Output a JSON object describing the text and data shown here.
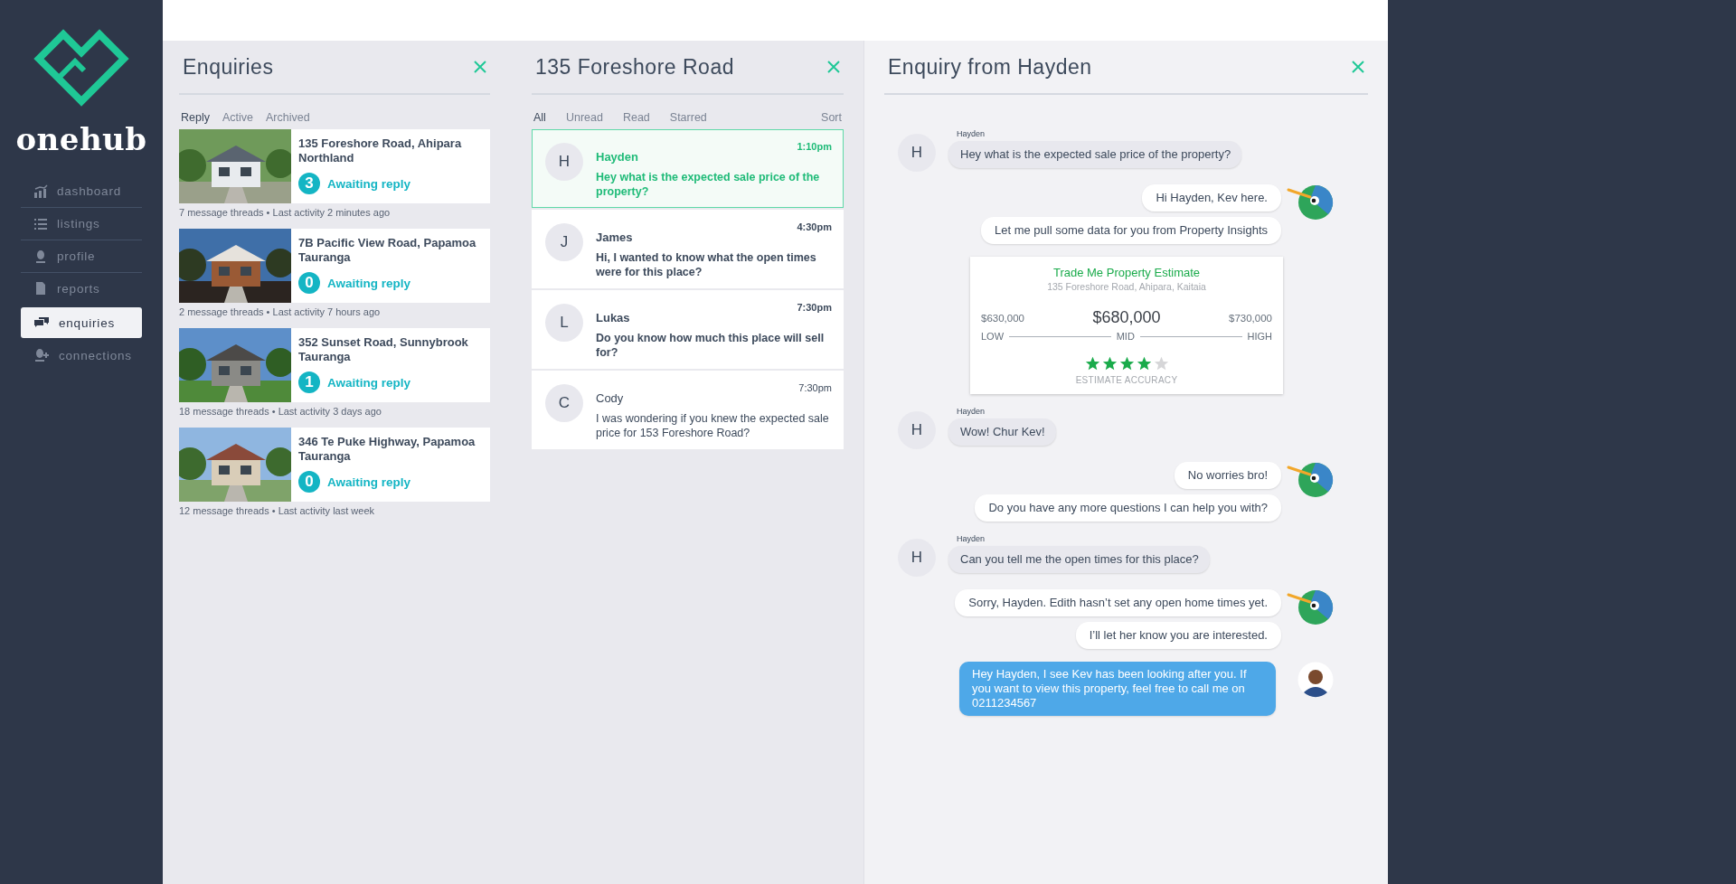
{
  "sidebar": {
    "brand": "onehub",
    "items": [
      {
        "label": "dashboard",
        "selected": false
      },
      {
        "label": "listings",
        "selected": false
      },
      {
        "label": "profile",
        "selected": false
      },
      {
        "label": "reports",
        "selected": false
      },
      {
        "label": "enquiries",
        "selected": true
      },
      {
        "label": "connections",
        "selected": false
      }
    ]
  },
  "enquiries": {
    "title": "Enquiries",
    "tabs": [
      {
        "label": "Reply",
        "selected": true
      },
      {
        "label": "Active",
        "selected": false
      },
      {
        "label": "Archived",
        "selected": false
      }
    ],
    "properties": [
      {
        "address": "135 Foreshore Road, Ahipara",
        "region": "Northland",
        "count": "3",
        "status": "Awaiting reply",
        "meta": "7 message threads • Last activity 2 minutes ago"
      },
      {
        "address": "7B Pacific View Road, Papamoa",
        "region": "Tauranga",
        "count": "0",
        "status": "Awaiting reply",
        "meta": "2 message threads • Last activity 7 hours ago"
      },
      {
        "address": "352 Sunset Road, Sunnybrook",
        "region": "Tauranga",
        "count": "1",
        "status": "Awaiting reply",
        "meta": "18 message threads • Last activity 3 days ago"
      },
      {
        "address": "346 Te Puke Highway, Papamoa",
        "region": "Tauranga",
        "count": "0",
        "status": "Awaiting reply",
        "meta": "12 message threads • Last activity last week"
      }
    ]
  },
  "threads": {
    "title": "135 Foreshore Road",
    "filters": [
      {
        "label": "All",
        "selected": true
      },
      {
        "label": "Unread",
        "selected": false
      },
      {
        "label": "Read",
        "selected": false
      },
      {
        "label": "Starred",
        "selected": false
      }
    ],
    "sort": "Sort",
    "items": [
      {
        "initial": "H",
        "name": "Hayden",
        "time": "1:10pm",
        "message": "Hey what is the expected sale price of the property?",
        "selected": true,
        "unread": true
      },
      {
        "initial": "J",
        "name": "James",
        "time": "4:30pm",
        "message": "Hi, I wanted to know what the open times were for this place?",
        "selected": false,
        "unread": true
      },
      {
        "initial": "L",
        "name": "Lukas",
        "time": "7:30pm",
        "message": "Do you know how much this place will sell for?",
        "selected": false,
        "unread": true
      },
      {
        "initial": "C",
        "name": "Cody",
        "time": "7:30pm",
        "message": "I was wondering if you knew the expected sale price for 153 Foreshore Road?",
        "selected": false,
        "unread": false
      }
    ]
  },
  "chat": {
    "title": "Enquiry from Hayden",
    "messages": [
      {
        "kind": "customer",
        "sender": "Hayden",
        "initial": "H",
        "bubbles": [
          "Hey what is the expected sale price of the property?"
        ]
      },
      {
        "kind": "bot",
        "bubbles": [
          "Hi Hayden, Kev here.",
          "Let me pull some data for you from Property Insights"
        ]
      },
      {
        "kind": "estimate",
        "title": "Trade Me Property Estimate",
        "address": "135 Foreshore Road, Ahipara, Kaitaia",
        "low": "$630,000",
        "mid": "$680,000",
        "high": "$730,000",
        "low_label": "LOW",
        "mid_label": "MID",
        "high_label": "HIGH",
        "stars": 4,
        "caption": "ESTIMATE ACCURACY"
      },
      {
        "kind": "customer",
        "sender": "Hayden",
        "initial": "H",
        "bubbles": [
          "Wow! Chur Kev!"
        ]
      },
      {
        "kind": "bot",
        "bubbles": [
          "No worries bro!",
          "Do you have any more questions I can help you with?"
        ]
      },
      {
        "kind": "customer",
        "sender": "Hayden",
        "initial": "H",
        "bubbles": [
          "Can you tell me the open times for this place?"
        ]
      },
      {
        "kind": "bot",
        "bubbles": [
          "Sorry, Hayden. Edith hasn’t set any open home times yet.",
          "I’ll let her know you are interested."
        ]
      },
      {
        "kind": "agent",
        "bubbles": [
          "Hey Hayden, I see Kev has been looking after you. If you want to view this property, feel free to call me on 0211234567"
        ]
      }
    ]
  }
}
